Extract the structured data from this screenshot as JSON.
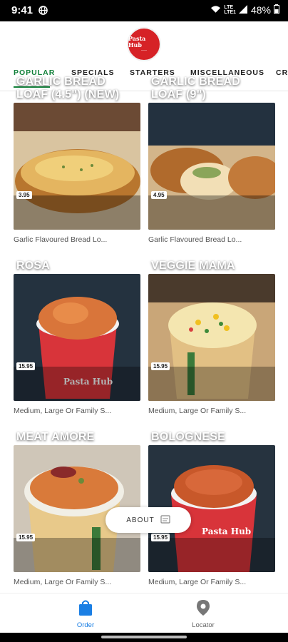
{
  "status": {
    "time": "9:41",
    "battery": "48%",
    "net_top": "LTE",
    "net_bottom": "LTE1"
  },
  "tabs": [
    "POPULAR",
    "SPECIALS",
    "STARTERS",
    "MISCELLANEOUS",
    "CR"
  ],
  "items": [
    {
      "price": "3.95",
      "title": "GARLIC BREAD LOAF (4.5\") (NEW)",
      "desc": "Garlic Flavoured Bread Lo..."
    },
    {
      "price": "4.95",
      "title": "GARLIC BREAD LOAF (9\")",
      "desc": "Garlic Flavoured Bread Lo..."
    },
    {
      "price": "15.95",
      "title": "ROSA",
      "desc": "Medium, Large Or Family S..."
    },
    {
      "price": "15.95",
      "title": "VEGGIE MAMA",
      "desc": "Medium, Large Or Family S..."
    },
    {
      "price": "15.95",
      "title": "MEAT AMORE",
      "desc": "Medium, Large Or Family S..."
    },
    {
      "price": "15.95",
      "title": "BOLOGNESE",
      "desc": "Medium, Large Or Family S..."
    }
  ],
  "about": {
    "label": "ABOUT"
  },
  "nav": {
    "order": "Order",
    "locator": "Locator"
  },
  "logo": {
    "name": "Pasta Hub"
  },
  "colors": {
    "accent": "#12813a",
    "nav_active": "#1b7fe4",
    "brand_red": "#d62226"
  }
}
